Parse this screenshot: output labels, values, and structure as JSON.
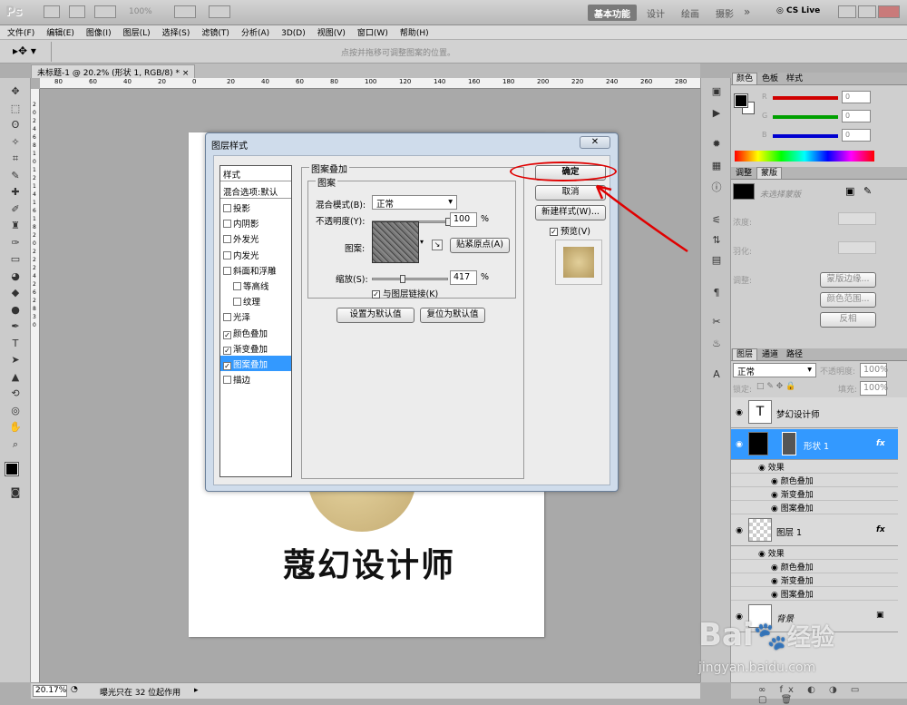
{
  "app": {
    "logo": "Ps",
    "zoom": "100%",
    "workspaces": [
      "基本功能",
      "设计",
      "绘画",
      "摄影"
    ],
    "cslive": "CS Live"
  },
  "menu": [
    "文件(F)",
    "编辑(E)",
    "图像(I)",
    "图层(L)",
    "选择(S)",
    "滤镜(T)",
    "分析(A)",
    "3D(D)",
    "视图(V)",
    "窗口(W)",
    "帮助(H)"
  ],
  "options_hint": "点按并拖移可调整图案的位置。",
  "doc_tab": "未标题-1 @ 20.2% (形状 1, RGB/8) *",
  "ruler_top": [
    "80",
    "60",
    "40",
    "20",
    "0",
    "20",
    "40",
    "60",
    "80",
    "100",
    "120",
    "140",
    "160",
    "180",
    "200",
    "220",
    "240",
    "260",
    "280"
  ],
  "ruler_left": [
    "2",
    "0",
    "2",
    "4",
    "6",
    "8",
    "1",
    "0",
    "1",
    "2",
    "1",
    "4",
    "1",
    "6",
    "1",
    "8",
    "2",
    "0",
    "2",
    "2",
    "2",
    "4",
    "2",
    "6",
    "2",
    "8",
    "3",
    "0"
  ],
  "canvas_text": "蔻幻设计师",
  "status": {
    "zoom": "20.17%",
    "info": "曝光只在 32 位起作用"
  },
  "dialog": {
    "title": "图层样式",
    "close": "✕",
    "styles_header": "样式",
    "blend_default": "混合选项:默认",
    "styles": [
      {
        "label": "投影",
        "checked": false,
        "indent": false
      },
      {
        "label": "内阴影",
        "checked": false,
        "indent": false
      },
      {
        "label": "外发光",
        "checked": false,
        "indent": false
      },
      {
        "label": "内发光",
        "checked": false,
        "indent": false
      },
      {
        "label": "斜面和浮雕",
        "checked": false,
        "indent": false
      },
      {
        "label": "等高线",
        "checked": false,
        "indent": true
      },
      {
        "label": "纹理",
        "checked": false,
        "indent": true
      },
      {
        "label": "光泽",
        "checked": false,
        "indent": false
      },
      {
        "label": "颜色叠加",
        "checked": true,
        "indent": false
      },
      {
        "label": "渐变叠加",
        "checked": true,
        "indent": false
      },
      {
        "label": "图案叠加",
        "checked": true,
        "indent": false,
        "selected": true
      },
      {
        "label": "描边",
        "checked": false,
        "indent": false
      }
    ],
    "section": "图案叠加",
    "subsection": "图案",
    "blend_mode_label": "混合模式(B):",
    "blend_mode": "正常",
    "opacity_label": "不透明度(Y):",
    "opacity": "100",
    "opacity_level": 1.0,
    "pattern_label": "图案:",
    "snap_button": "贴紧原点(A)",
    "scale_label": "缩放(S):",
    "scale": "417",
    "scale_level": 0.41,
    "pct": "%",
    "link_label": "与图层链接(K)",
    "link_checked": true,
    "set_default": "设置为默认值",
    "reset_default": "复位为默认值",
    "ok": "确定",
    "cancel": "取消",
    "new_style": "新建样式(W)...",
    "preview_label": "预览(V)",
    "preview_checked": true
  },
  "color_panel": {
    "tabs": [
      "颜色",
      "色板",
      "样式"
    ],
    "channels": [
      {
        "ch": "R",
        "val": "0",
        "color": "#d00000"
      },
      {
        "ch": "G",
        "val": "0",
        "color": "#00a000"
      },
      {
        "ch": "B",
        "val": "0",
        "color": "#0000d0"
      }
    ]
  },
  "adjust_panel": {
    "tabs": [
      "调整",
      "蒙版"
    ],
    "mask_label": "未选择蒙版",
    "density": "浓度:",
    "feather": "羽化:",
    "refine": "调整:",
    "buttons": [
      "蒙版边缘...",
      "颜色范围...",
      "反相"
    ]
  },
  "layers_panel": {
    "tabs": [
      "图层",
      "通道",
      "路径"
    ],
    "blend": "正常",
    "opacity_label": "不透明度:",
    "opacity": "100%",
    "lock_label": "锁定:",
    "fill_label": "填充:",
    "fill": "100%",
    "layers": [
      {
        "name": "梦幻设计师",
        "type": "text"
      },
      {
        "name": "形状 1",
        "type": "shape",
        "selected": true,
        "fx": "fx",
        "effects_label": "效果",
        "effects": [
          "颜色叠加",
          "渐变叠加",
          "图案叠加"
        ]
      },
      {
        "name": "图层 1",
        "type": "pixel",
        "fx": "fx",
        "effects_label": "效果",
        "effects": [
          "颜色叠加",
          "渐变叠加",
          "图案叠加"
        ]
      },
      {
        "name": "背景",
        "type": "bg"
      }
    ]
  },
  "watermark": {
    "brand": "Bai",
    "brand2": "经验",
    "url": "jingyan.baidu.com"
  }
}
